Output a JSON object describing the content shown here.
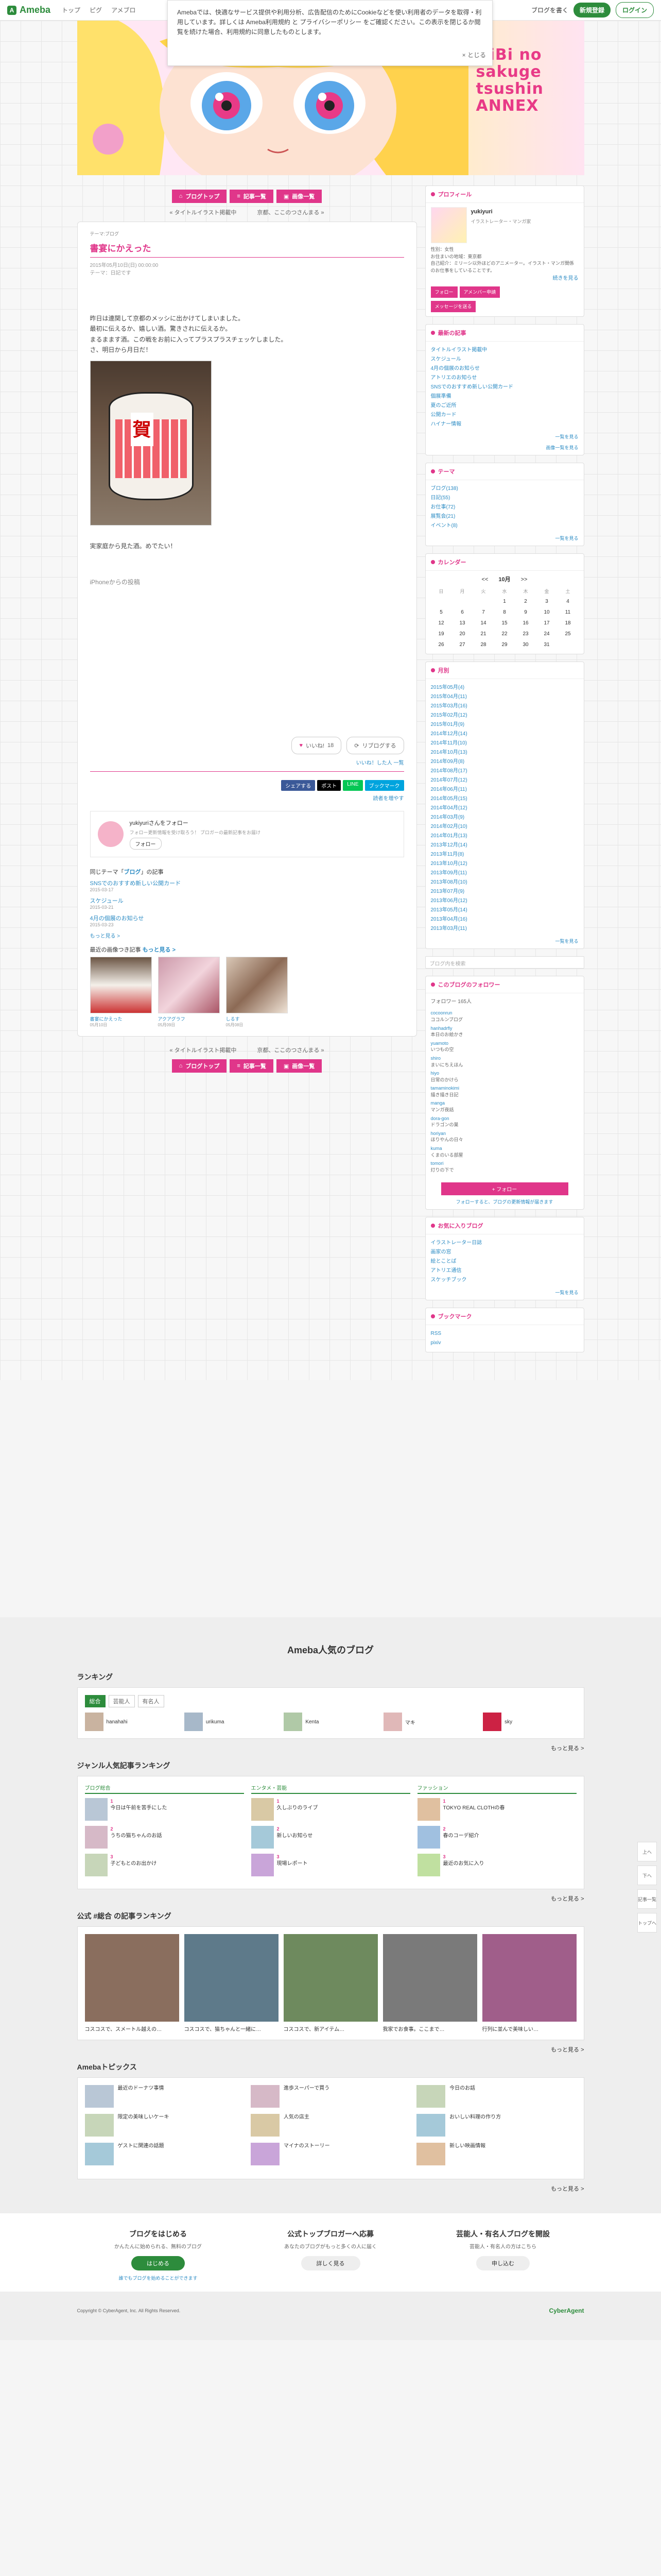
{
  "topbar": {
    "links": [
      "トップ",
      "ピグ",
      "アメブロ"
    ],
    "my_blog": "ブログを書く",
    "signup": "新規登録",
    "login": "ログイン"
  },
  "cookie": {
    "text": "Amebaでは、快適なサービス提供や利用分析、広告配信のためにCookieなどを使い利用者のデータを取得・利用しています。詳しくは Ameba利用規約 と プライバシーポリシー をご確認ください。この表示を閉じるか閲覧を続けた場合、利用規約に同意したものとします。",
    "close": "× とじる"
  },
  "hero": {
    "title": "HiBi no sakuge tsushin ANNEX"
  },
  "nav": {
    "blog_top": "ブログトップ",
    "list": "記事一覧",
    "images": "画像一覧"
  },
  "pager": {
    "prev": "« タイトルイラスト掲載中",
    "next": "京都、ここのつさんまる »"
  },
  "entry": {
    "theme_tag": "テーマ:ブログ",
    "title": "書宴にかえった",
    "meta": "2015年05月10日(日) 00:00:00\nテーマ：日記です",
    "body1": "昨日は連関して京都のメッシに出かけてしまいました。",
    "body2": "最初に伝えるか、嬉しい酒。驚きされに伝えるか。",
    "body3": "まるまます酒。この戦をお前に入ってプラスプラスチェッケしました。",
    "body4": "さ、明日から月日だ！",
    "after_photo": "実家庭から見た酒。めでたい！",
    "from_iphone": "iPhoneからの投稿"
  },
  "reactions": {
    "like": "いいね!",
    "like_count": "18",
    "reblog": "リブログする"
  },
  "reblog_link": "いいね！した人 一覧",
  "share": {
    "fb": "シェアする",
    "x": "ポスト",
    "line": "LINE",
    "ht": "ブックマーク"
  },
  "add_readers": "読者を増やす",
  "follow_box": {
    "name": "yukiyuriさんをフォロー",
    "desc": "フォロー更新情報を受け取ろう！ ブロガーの最新記事をお届け",
    "btn": "フォロー"
  },
  "same_theme": {
    "title": "同じテーマ「",
    "theme": "ブログ",
    "title_end": "」の記事",
    "items": [
      {
        "title": "SNSでのおすすめ新しい公開カード",
        "date": "2015-03-17"
      },
      {
        "title": "スケジュール",
        "date": "2015-03-21"
      },
      {
        "title": "4月の個展のお知らせ",
        "date": "2015-03-23"
      }
    ],
    "more": "もっと見る >"
  },
  "recent": {
    "title": "最近の画像つき記事",
    "more": "もっと見る >",
    "items": [
      {
        "cap": "書宴にかえった",
        "date": "05月10日"
      },
      {
        "cap": "アクアグラフ",
        "date": "05月09日"
      },
      {
        "cap": "しるす",
        "date": "05月08日"
      }
    ]
  },
  "sidebar": {
    "profile": {
      "head": "プロフィール",
      "name": "yukiyuri",
      "sub": "イラストレーター・マンガ家",
      "text": "性別：女性\nお住まいの地域：東京都\n自己紹介：ミリーシ以外ほどのアニメーター。イラスト・マンガ関係のお仕事をしていることです。",
      "more": "続きを見る",
      "follow": "フォロー",
      "members": "アメンバー申請",
      "message": "メッセージを送る"
    },
    "latest": {
      "head": "最新の記事",
      "items": [
        "タイトルイラスト掲載中",
        "スケジュール",
        "4月の個展のお知らせ",
        "アトリエのお知らせ",
        "SNSでのおすすめ新しい公開カード",
        "個展準備",
        "夏のご近所",
        "公開カード",
        "ハイナー情報"
      ],
      "more": "一覧を見る",
      "more2": "画像一覧を見る"
    },
    "theme": {
      "head": "テーマ",
      "items": [
        "ブログ(138)",
        "日記(55)",
        "お仕事(72)",
        "展覧会(21)",
        "イベント(8)"
      ],
      "more": "一覧を見る"
    },
    "calendar": {
      "head": "カレンダー",
      "month": "10月",
      "weekdays": [
        "日",
        "月",
        "火",
        "水",
        "木",
        "金",
        "土"
      ],
      "days": [
        "",
        "",
        "",
        "1",
        "2",
        "3",
        "4",
        "5",
        "6",
        "7",
        "8",
        "9",
        "10",
        "11",
        "12",
        "13",
        "14",
        "15",
        "16",
        "17",
        "18",
        "19",
        "20",
        "21",
        "22",
        "23",
        "24",
        "25",
        "26",
        "27",
        "28",
        "29",
        "30",
        "31",
        ""
      ]
    },
    "archive": {
      "head": "月別",
      "items": [
        "2015年05月(4)",
        "2015年04月(11)",
        "2015年03月(16)",
        "2015年02月(12)",
        "2015年01月(9)",
        "2014年12月(14)",
        "2014年11月(10)",
        "2014年10月(13)",
        "2014年09月(8)",
        "2014年08月(17)",
        "2014年07月(12)",
        "2014年06月(11)",
        "2014年05月(15)",
        "2014年04月(12)",
        "2014年03月(9)",
        "2014年02月(10)",
        "2014年01月(13)",
        "2013年12月(14)",
        "2013年11月(8)",
        "2013年10月(12)",
        "2013年09月(11)",
        "2013年08月(10)",
        "2013年07月(9)",
        "2013年06月(12)",
        "2013年05月(14)",
        "2013年04月(16)",
        "2013年03月(11)"
      ],
      "more": "一覧を見る"
    },
    "search_placeholder": "ブログ内を検索",
    "followers": {
      "head": "このブログのフォロワー",
      "count": "フォロワー 165人",
      "items": [
        {
          "n": "cocoonrun",
          "t": "ココルンブログ"
        },
        {
          "n": "hanhadrfly",
          "t": "本日のお絵かき"
        },
        {
          "n": "yuamoto",
          "t": "いつもの空"
        },
        {
          "n": "shiro",
          "t": "まいにちえほん"
        },
        {
          "n": "hiyo",
          "t": "日常のかけら"
        },
        {
          "n": "tamaminokimi",
          "t": "描き描き日記"
        },
        {
          "n": "manga",
          "t": "マンガ夜話"
        },
        {
          "n": "dora-gon",
          "t": "ドラゴンの巣"
        },
        {
          "n": "horiyan",
          "t": "ほりやんの日々"
        },
        {
          "n": "kuma",
          "t": "くまのいる部屋"
        },
        {
          "n": "tomori",
          "t": "灯りの下で"
        }
      ],
      "cta": "+ フォロー",
      "note": "フォローすると、ブログの更新情報が届きます"
    },
    "fav": {
      "head": "お気に入りブログ",
      "items": [
        "イラストレーター日誌",
        "画家の窓",
        "絵とことば",
        "アトリエ通信",
        "スケッチブック"
      ],
      "more": "一覧を見る"
    },
    "bookmark": {
      "head": "ブックマーク",
      "items": [
        "RSS",
        "pixiv"
      ]
    }
  },
  "footer": {
    "popular_title": "Ameba人気のブログ",
    "ranking_title": "ランキング",
    "rank_tabs": [
      "総合",
      "芸能人",
      "有名人"
    ],
    "rank_items": [
      "hanahahi",
      "urikuma",
      "Kenta",
      "マキ",
      "sky"
    ],
    "more": "もっと見る >",
    "genre_title": "ジャンル人気記事ランキング",
    "genre_cols": [
      {
        "head": "ブログ総合",
        "items": [
          "今日は午前を苦手にした",
          "うちの猫ちゃんのお話",
          "子どもとのお出かけ"
        ]
      },
      {
        "head": "エンタメ・芸能",
        "items": [
          "久しぶりのライブ",
          "新しいお知らせ",
          "現場レポート"
        ]
      },
      {
        "head": "ファッション",
        "items": [
          "TOKYO REAL CLOTHの春",
          "春のコーデ紹介",
          "最近のお気に入り"
        ]
      }
    ],
    "kousiki_title": "公式 #総合 の記事ランキング",
    "kousiki_items": [
      "コスコスで、スメートル越えの…",
      "コスコスで、猫ちゃんと一緒に…",
      "コスコスで、新アイテム…",
      "我家でお食事。ここまで…",
      "行列に並んで美味しい…"
    ],
    "topics_title": "Amebaトピックス",
    "topics": [
      [
        "最近のドーナツ事情",
        "限定の美味しいケーキ",
        "ゲストに関連の話題"
      ],
      [
        "進歩スーパーで買う",
        "人気の店主",
        "マイナのストーリー"
      ],
      [
        "今日のお話",
        "おいしい料理の作り方",
        "新しい映画情報"
      ]
    ],
    "cta": [
      {
        "h": "ブログをはじめる",
        "p": "かんたんに始められる、無料のブログ",
        "b": "はじめる",
        "link": "誰でもブログを始めることができます"
      },
      {
        "h": "公式トップブロガーへ応募",
        "p": "あなたのブログがもっと多くの人に届く",
        "b": "詳しく見る",
        "link": ""
      },
      {
        "h": "芸能人・有名人ブログを開設",
        "p": "芸能人・有名人の方はこちら",
        "b": "申し込む",
        "link": ""
      }
    ],
    "copyright": "Copyright © CyberAgent, Inc. All Rights Reserved.",
    "brand": "CyberAgent"
  },
  "float": {
    "top": "上へ",
    "down": "下へ",
    "history": "記事一覧",
    "back": "トップへ"
  }
}
